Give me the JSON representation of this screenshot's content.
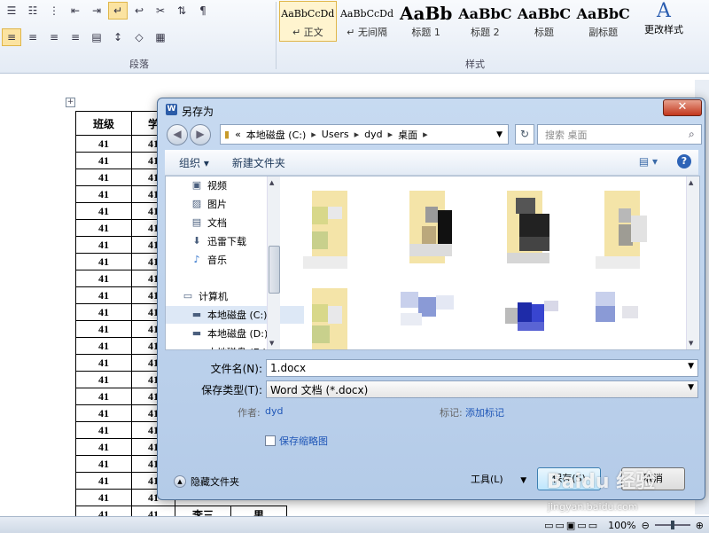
{
  "ribbon": {
    "paragraph_label": "段落",
    "styles_label": "样式",
    "style_samples": [
      {
        "sample": "AaBbCcDd",
        "name": "↵ 正文"
      },
      {
        "sample": "AaBbCcDd",
        "name": "↵ 无间隔"
      },
      {
        "sample": "AaBb",
        "name": "标题 1"
      },
      {
        "sample": "AaBbC",
        "name": "标题 2"
      },
      {
        "sample": "AaBbC",
        "name": "标题"
      },
      {
        "sample": "AaBbC",
        "name": "副标题"
      }
    ],
    "change_styles_label": "更改样式",
    "change_styles_glyph": "A"
  },
  "document": {
    "table_header": [
      "班级",
      "学"
    ],
    "class_value": "41",
    "partial_row": [
      "41",
      "41",
      "李三",
      "男"
    ]
  },
  "status_bar": {
    "zoom": "100%"
  },
  "dialog": {
    "title": "另存为",
    "title_icon": "W",
    "close": "✕",
    "address_parts": [
      "«",
      "本地磁盘 (C:)",
      "Users",
      "dyd",
      "桌面"
    ],
    "search_placeholder": "搜索 桌面",
    "toolbar": {
      "organize": "组织 ▾",
      "new_folder": "新建文件夹"
    },
    "nav_items": [
      {
        "label": "视频",
        "icon": "video-icon"
      },
      {
        "label": "图片",
        "icon": "pictures-icon"
      },
      {
        "label": "文档",
        "icon": "documents-icon"
      },
      {
        "label": "迅雷下载",
        "icon": "download-icon"
      },
      {
        "label": "音乐",
        "icon": "music-icon"
      },
      {
        "label": "计算机",
        "icon": "computer-icon"
      },
      {
        "label": "本地磁盘 (C:)",
        "icon": "drive-icon"
      },
      {
        "label": "本地磁盘 (D:)",
        "icon": "drive-icon"
      },
      {
        "label": "本地磁盘 (E:)",
        "icon": "drive-icon"
      }
    ],
    "filename_label": "文件名(N):",
    "filename_value": "1.docx",
    "filetype_label": "保存类型(T):",
    "filetype_value": "Word 文档 (*.docx)",
    "author_label": "作者:",
    "author_value": "dyd",
    "tags_label": "标记:",
    "tags_value": "添加标记",
    "thumbnail_label": "保存缩略图",
    "hide_folders": "隐藏文件夹",
    "tools": "工具(L)",
    "save": "保存(S)",
    "cancel": "取消"
  },
  "watermark": {
    "text": "Baidu 经验",
    "url": "jingyan.baidu.com"
  }
}
